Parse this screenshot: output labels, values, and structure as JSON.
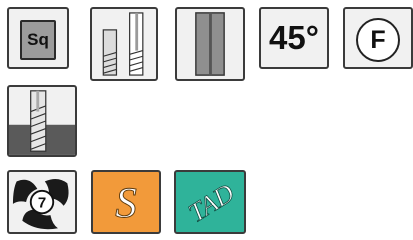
{
  "icons": {
    "square": {
      "label": "Sq"
    },
    "angle": {
      "label": "45°"
    },
    "finish": {
      "label": "F"
    },
    "series": {
      "number": "7"
    },
    "s_badge": {
      "label": "S",
      "color": "#f29a3a"
    },
    "tad_badge": {
      "label": "TAD",
      "color": "#2fb39a"
    }
  }
}
